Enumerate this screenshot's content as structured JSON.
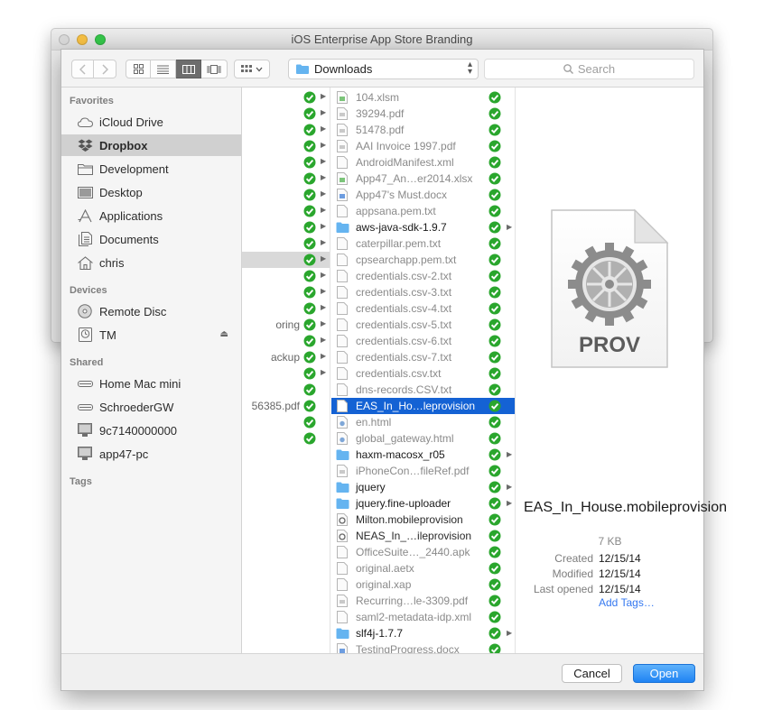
{
  "window": {
    "title": "iOS Enterprise App Store Branding"
  },
  "colors": {
    "accent": "#1462d4",
    "check": "#2aa62d",
    "link": "#3478f0"
  },
  "toolbar": {
    "location": "Downloads",
    "search_placeholder": "Search",
    "back_icon": "chevron-left-icon",
    "forward_icon": "chevron-right-icon",
    "view_mode_selected": "columns"
  },
  "sidebar": {
    "favorites_heading": "Favorites",
    "favorites": [
      {
        "label": "iCloud Drive",
        "icon": "cloud-icon"
      },
      {
        "label": "Dropbox",
        "icon": "dropbox-icon",
        "selected": true
      },
      {
        "label": "Development",
        "icon": "folder-icon"
      },
      {
        "label": "Desktop",
        "icon": "desktop-icon"
      },
      {
        "label": "Applications",
        "icon": "applications-icon"
      },
      {
        "label": "Documents",
        "icon": "documents-icon"
      },
      {
        "label": "chris",
        "icon": "home-icon"
      }
    ],
    "devices_heading": "Devices",
    "devices": [
      {
        "label": "Remote Disc",
        "icon": "disc-icon"
      },
      {
        "label": "TM",
        "icon": "timemachine-icon"
      }
    ],
    "shared_heading": "Shared",
    "shared": [
      {
        "label": "Home Mac mini",
        "icon": "server-icon"
      },
      {
        "label": "SchroederGW",
        "icon": "server-icon"
      },
      {
        "label": "9c7140000000",
        "icon": "display-icon"
      },
      {
        "label": "app47-pc",
        "icon": "display-icon"
      }
    ],
    "tags_heading": "Tags"
  },
  "column1": {
    "visible_texts": [
      "oring",
      "ackup",
      "56385.pdf"
    ]
  },
  "files": [
    {
      "name": "104.xlsm",
      "kind": "xls"
    },
    {
      "name": "39294.pdf",
      "kind": "pdf"
    },
    {
      "name": "51478.pdf",
      "kind": "pdf"
    },
    {
      "name": "AAI Invoice 1997.pdf",
      "kind": "pdf"
    },
    {
      "name": "AndroidManifest.xml",
      "kind": "doc"
    },
    {
      "name": "App47_An…er2014.xlsx",
      "kind": "xls"
    },
    {
      "name": "App47's Must.docx",
      "kind": "word"
    },
    {
      "name": "appsana.pem.txt",
      "kind": "doc"
    },
    {
      "name": "aws-java-sdk-1.9.7",
      "kind": "folder"
    },
    {
      "name": "caterpillar.pem.txt",
      "kind": "doc"
    },
    {
      "name": "cpsearchapp.pem.txt",
      "kind": "doc"
    },
    {
      "name": "credentials.csv-2.txt",
      "kind": "doc"
    },
    {
      "name": "credentials.csv-3.txt",
      "kind": "doc"
    },
    {
      "name": "credentials.csv-4.txt",
      "kind": "doc"
    },
    {
      "name": "credentials.csv-5.txt",
      "kind": "doc"
    },
    {
      "name": "credentials.csv-6.txt",
      "kind": "doc"
    },
    {
      "name": "credentials.csv-7.txt",
      "kind": "doc"
    },
    {
      "name": "credentials.csv.txt",
      "kind": "doc"
    },
    {
      "name": "dns-records.CSV.txt",
      "kind": "doc"
    },
    {
      "name": "EAS_In_Ho…leprovision",
      "kind": "doc",
      "selected": true
    },
    {
      "name": "en.html",
      "kind": "html"
    },
    {
      "name": "global_gateway.html",
      "kind": "html"
    },
    {
      "name": "haxm-macosx_r05",
      "kind": "folder"
    },
    {
      "name": "iPhoneCon…fileRef.pdf",
      "kind": "pdf"
    },
    {
      "name": "jquery",
      "kind": "folder"
    },
    {
      "name": "jquery.fine-uploader",
      "kind": "folder"
    },
    {
      "name": "Milton.mobileprovision",
      "kind": "prov"
    },
    {
      "name": "NEAS_In_…ileprovision",
      "kind": "prov"
    },
    {
      "name": "OfficeSuite…_2440.apk",
      "kind": "doc"
    },
    {
      "name": "original.aetx",
      "kind": "doc"
    },
    {
      "name": "original.xap",
      "kind": "doc"
    },
    {
      "name": "Recurring…le-3309.pdf",
      "kind": "pdf"
    },
    {
      "name": "saml2-metadata-idp.xml",
      "kind": "doc"
    },
    {
      "name": "slf4j-1.7.7",
      "kind": "folder"
    },
    {
      "name": "TestingProgress.docx",
      "kind": "word"
    }
  ],
  "preview": {
    "doc_label": "PROV",
    "name": "EAS_In_House.mobileprovision",
    "size": "7 KB",
    "created_label": "Created",
    "created": "12/15/14",
    "modified_label": "Modified",
    "modified": "12/15/14",
    "last_opened_label": "Last opened",
    "last_opened": "12/15/14",
    "add_tags": "Add Tags…"
  },
  "buttons": {
    "cancel": "Cancel",
    "open": "Open"
  }
}
